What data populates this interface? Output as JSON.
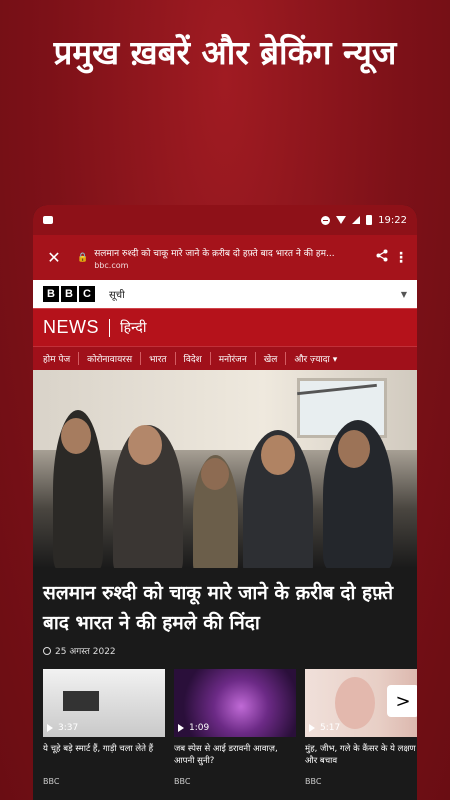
{
  "promo": {
    "title": "प्रमुख ख़बरें और ब्रेकिंग न्यूज"
  },
  "status_bar": {
    "time": "19:22"
  },
  "browser": {
    "page_title": "सलमान रुश्दी को चाकू मारे जाने के क़रीब दो हफ़्ते बाद भारत ने की हम...",
    "domain": "bbc.com",
    "close_label": "✕",
    "share_label": "⋖",
    "more_label": "⋮"
  },
  "site": {
    "logo_letters": [
      "B",
      "B",
      "C"
    ],
    "menu_label": "सूची",
    "news_label": "NEWS",
    "language_label": "हिन्दी",
    "nav": [
      "होम पेज",
      "कोरोनावायरस",
      "भारत",
      "विदेश",
      "मनोरंजन",
      "खेल",
      "और ज़्यादा ▾"
    ]
  },
  "lead_story": {
    "headline": "सलमान रुश्दी को चाकू मारे जाने के क़रीब दो हफ़्ते बाद भारत ने की हमले की निंदा",
    "date": "25 अगस्त 2022"
  },
  "videos": [
    {
      "duration": "3:37",
      "title": "ये चूहे बड़े स्मार्ट हैं, गाड़ी चला लेते हैं",
      "source": "BBC"
    },
    {
      "duration": "1:09",
      "title": "जब स्पेस से आई डरावनी आवाज़, आपनी सुनी?",
      "source": "BBC"
    },
    {
      "duration": "5:17",
      "title": "मुंह, जीभ, गले के कैंसर के ये लक्षण और बचाव",
      "source": "BBC"
    }
  ],
  "carousel": {
    "next_label": ">"
  }
}
